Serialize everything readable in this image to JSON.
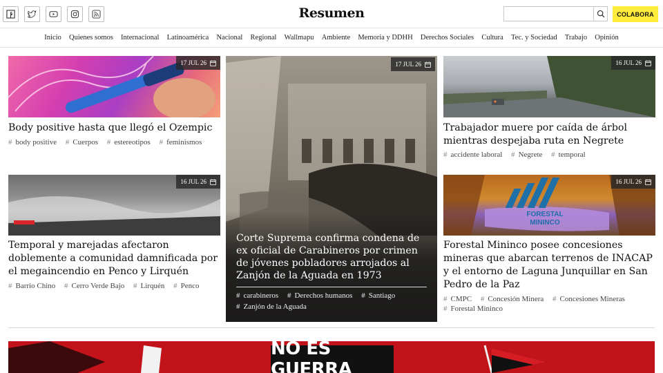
{
  "header": {
    "logo": "Resumen",
    "social_icons": [
      "facebook-icon",
      "twitter-icon",
      "youtube-icon",
      "instagram-icon",
      "rss-icon"
    ],
    "search": {
      "placeholder": "",
      "value": ""
    },
    "colabora_label": "COLABORA",
    "colabora_color": "#ffeb3b"
  },
  "nav": {
    "items": [
      "Inicio",
      "Quienes somos",
      "Internacional",
      "Latinoamérica",
      "Nacional",
      "Regional",
      "Wallmapu",
      "Ambiente",
      "Memoria y DDHH",
      "Derechos Sociales",
      "Cultura",
      "Tec. y Sociedad",
      "Trabajo",
      "Opinión"
    ]
  },
  "articles": {
    "a1": {
      "date": "17 JUL 26",
      "title": "Body positive hasta que llegó el Ozempic",
      "tags": [
        "body positive",
        "Cuerpos",
        "estereotipos",
        "feminismos"
      ]
    },
    "a2": {
      "date": "16 JUL 26",
      "title": "Temporal y marejadas afectaron doblemente a comunidad damnificada por el megaincendio en Penco y Lirquén",
      "tags": [
        "Barrio Chino",
        "Cerro Verde Bajo",
        "Lirquén",
        "Penco"
      ]
    },
    "featured": {
      "date": "17 JUL 26",
      "title": "Corte Suprema confirma condena de ex oficial de Carabineros por crimen de jóvenes pobladores arrojados al Zanjón de la Aguada en 1973",
      "tags": [
        "carabineros",
        "Derechos humanos",
        "Santiago",
        "Zanjón de la Aguada"
      ]
    },
    "a3": {
      "date": "16 JUL 26",
      "title": "Trabajador muere por caída de árbol mientras despejaba ruta en Negrete",
      "tags": [
        "accidente laboral",
        "Negrete",
        "temporal"
      ]
    },
    "a4": {
      "date": "16 JUL 26",
      "title": "Forestal Mininco posee concesiones mineras que abarcan terrenos de INACAP y el entorno de Laguna Junquillar en San Pedro de la Paz",
      "tags": [
        "CMPC",
        "Concesión Minera",
        "Concesiones Mineras",
        "Forestal Mininco"
      ],
      "image_logo_text": [
        "FORESTAL",
        "MININCO"
      ]
    }
  },
  "banner": {
    "text": "NO ES GUERRA",
    "color": "#c2121a"
  }
}
